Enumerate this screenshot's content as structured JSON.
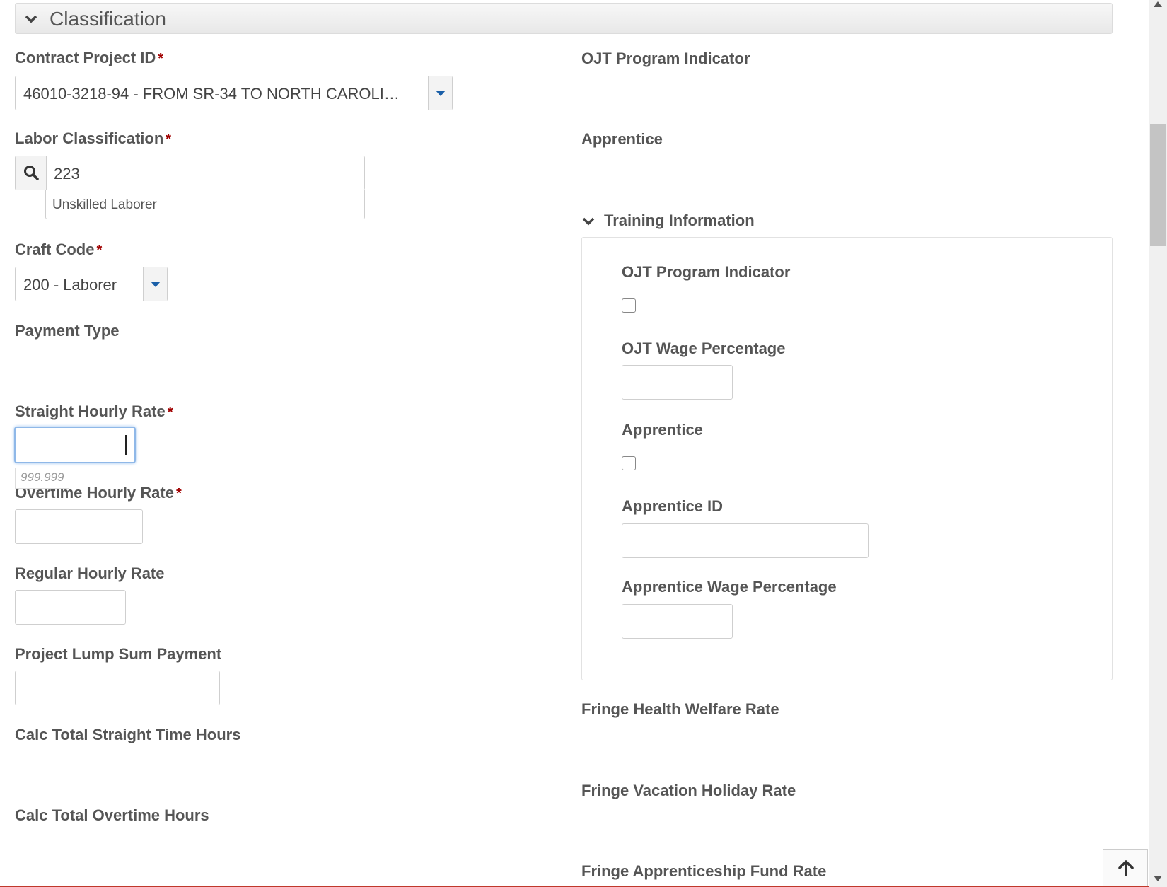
{
  "section": {
    "title": "Classification",
    "icon": "chevron-down-icon"
  },
  "left": {
    "contract_project_id": {
      "label": "Contract Project ID",
      "value": "46010-3218-94 - FROM SR-34 TO NORTH CAROLI…"
    },
    "labor_classification": {
      "label": "Labor Classification",
      "value": "223",
      "description": "Unskilled Laborer"
    },
    "craft_code": {
      "label": "Craft Code",
      "value": "200 - Laborer"
    },
    "payment_type": {
      "label": "Payment Type"
    },
    "straight_hourly_rate": {
      "label": "Straight Hourly Rate",
      "value": "",
      "hint": "999.999"
    },
    "overtime_hourly_rate": {
      "label": "Overtime Hourly Rate",
      "value": ""
    },
    "regular_hourly_rate": {
      "label": "Regular Hourly Rate",
      "value": ""
    },
    "project_lump_sum_payment": {
      "label": "Project Lump Sum Payment",
      "value": ""
    },
    "calc_total_straight_time_hours": {
      "label": "Calc Total Straight Time Hours"
    },
    "calc_total_overtime_hours": {
      "label": "Calc Total Overtime Hours"
    }
  },
  "right": {
    "ojt_program_indicator": {
      "label": "OJT Program Indicator"
    },
    "apprentice": {
      "label": "Apprentice"
    },
    "training_information": {
      "title": "Training Information",
      "ojt_program_indicator": {
        "label": "OJT Program Indicator",
        "checked": false
      },
      "ojt_wage_percentage": {
        "label": "OJT Wage Percentage",
        "value": ""
      },
      "apprentice": {
        "label": "Apprentice",
        "checked": false
      },
      "apprentice_id": {
        "label": "Apprentice ID",
        "value": ""
      },
      "apprentice_wage_percentage": {
        "label": "Apprentice Wage Percentage",
        "value": ""
      }
    },
    "fringe_health_welfare_rate": {
      "label": "Fringe Health Welfare Rate"
    },
    "fringe_vacation_holiday_rate": {
      "label": "Fringe Vacation Holiday Rate"
    },
    "fringe_apprenticeship_fund_rate": {
      "label": "Fringe Apprenticeship Fund Rate"
    }
  },
  "colors": {
    "required": "#a00000",
    "dropdown_arrow": "#1a5fa8",
    "focus": "#8fb8e8"
  }
}
